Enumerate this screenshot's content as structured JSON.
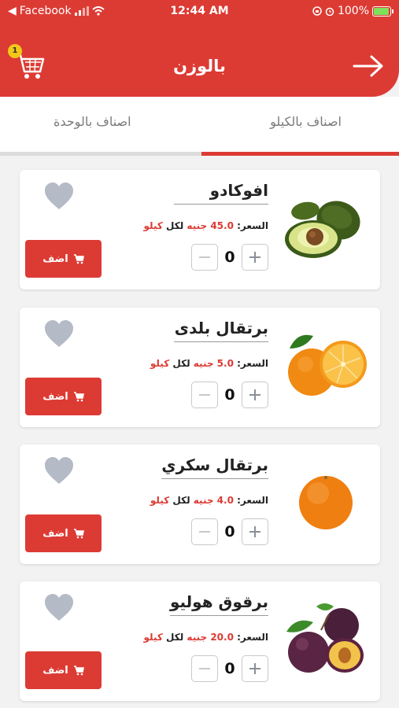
{
  "status_bar": {
    "back_app": "Facebook",
    "time": "12:44 AM",
    "battery": "100%"
  },
  "header": {
    "title": "بالوزن",
    "cart_count": "1"
  },
  "tabs": {
    "by_kilo": "اصناف بالكيلو",
    "by_unit": "اصناف بالوحدة"
  },
  "colors": {
    "accent": "#dc3b34",
    "badge": "#f3c719"
  },
  "products": [
    {
      "name": "افوكادو",
      "price_label": "السعر:",
      "price": "45.0 جنيه",
      "per": "لكل",
      "unit": "كيلو",
      "qty": "0",
      "add_label": "اضف"
    },
    {
      "name": "برتقال بلدى",
      "price_label": "السعر:",
      "price": "5.0 جنيه",
      "per": "لكل",
      "unit": "كيلو",
      "qty": "0",
      "add_label": "اضف"
    },
    {
      "name": "برتقال سكري",
      "price_label": "السعر:",
      "price": "4.0 جنيه",
      "per": "لكل",
      "unit": "كيلو",
      "qty": "0",
      "add_label": "اضف"
    },
    {
      "name": "برقوق هوليو",
      "price_label": "السعر:",
      "price": "20.0 جنيه",
      "per": "لكل",
      "unit": "كيلو",
      "qty": "0",
      "add_label": "اضف"
    }
  ]
}
